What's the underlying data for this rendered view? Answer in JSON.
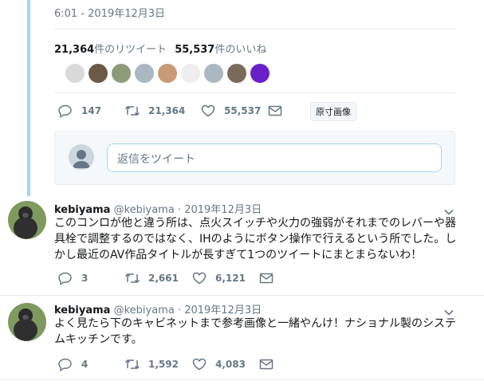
{
  "main_tweet": {
    "timestamp": "6:01 - 2019年12月3日",
    "retweet_count": "21,364",
    "retweet_label": "件のリツイート",
    "like_count": "55,537",
    "like_label": "件のいいね",
    "actions": {
      "replies": "147",
      "retweets": "21,364",
      "likes": "55,537"
    },
    "original_image_label": "原寸画像"
  },
  "liker_avatar_colors": [
    "#d9d9d9",
    "#6b5a4a",
    "#8c9c7a",
    "#aab8c2",
    "#c99a78",
    "#eeeeee",
    "#aab8c2",
    "#7a6a5a",
    "#6a1fc8"
  ],
  "reply_box": {
    "placeholder": "返信をツイート"
  },
  "replies": [
    {
      "name": "kebiyama",
      "handle": "@kebiyama",
      "date": "· 2019年12月3日",
      "text": "このコンロが他と違う所は、点火スイッチや火力の強弱がそれまでのレバーや器具栓で調整するのではなく、IHのようにボタン操作で行えるという所でした。しかし最近のAV作品タイトルが長すぎて1つのツイートにまとまらないわ！",
      "actions": {
        "replies": "3",
        "retweets": "2,661",
        "likes": "6,121"
      }
    },
    {
      "name": "kebiyama",
      "handle": "@kebiyama",
      "date": "· 2019年12月3日",
      "text": "よく見たら下のキャビネットまで参考画像と一緒やんけ！ナショナル製のシステムキッチンです。",
      "actions": {
        "replies": "4",
        "retweets": "1,592",
        "likes": "4,083"
      }
    }
  ],
  "colors": {
    "accent": "#1da1f2",
    "thread_line": "#a7d3f4",
    "muted": "#657786"
  }
}
